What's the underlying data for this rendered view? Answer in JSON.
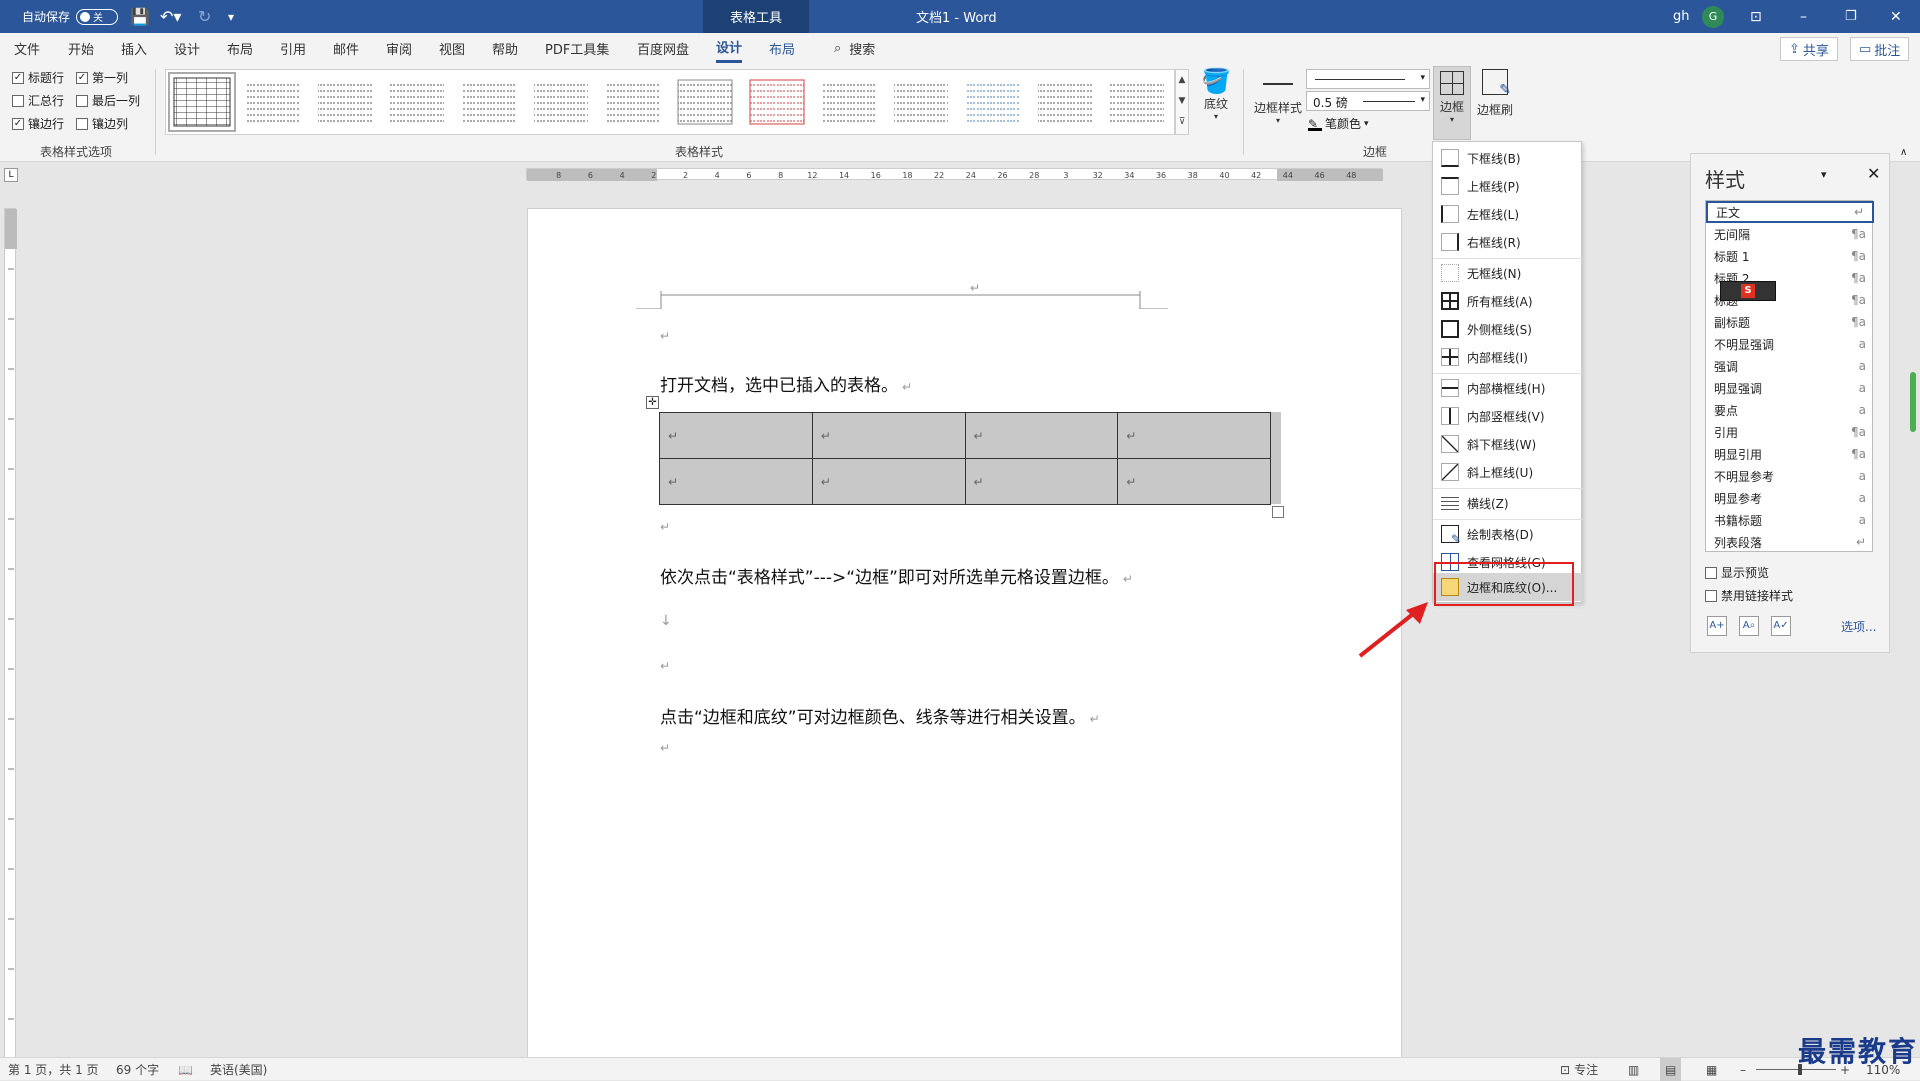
{
  "titlebar": {
    "autosave": "自动保存",
    "toggle": "关",
    "context_tab": "表格工具",
    "doc_title": "文档1 - Word",
    "user": "gh",
    "avatar": "G",
    "minimize": "–",
    "restore": "❐",
    "close": "✕",
    "ribbon_display": "⊡"
  },
  "tabs": [
    "文件",
    "开始",
    "插入",
    "设计",
    "布局",
    "引用",
    "邮件",
    "审阅",
    "视图",
    "帮助",
    "PDF工具集",
    "百度网盘",
    "设计",
    "布局"
  ],
  "search": "搜索",
  "share": "共享",
  "comment": "批注",
  "options": {
    "header_row": "标题行",
    "first_col": "第一列",
    "total_row": "汇总行",
    "last_col": "最后一列",
    "banded_rows": "镶边行",
    "banded_cols": "镶边列",
    "group_label": "表格样式选项"
  },
  "gallery_label": "表格样式",
  "shading": "底纹",
  "border_styles": "边框样式",
  "line_weight": "0.5 磅",
  "pen_color": "笔颜色",
  "borders": "边框",
  "border_painter": "边框刷",
  "border_group_label": "边框",
  "colors": {
    "accent": "#2b579a",
    "highlight": "#e02020",
    "table_fill": "#c8c8c8"
  },
  "document": {
    "line1": "打开文档，选中已插入的表格。",
    "line2": "依次点击“表格样式”--->“边框”即可对所选单元格设置边框。",
    "line3": "点击“边框和底纹”可对边框颜色、线条等进行相关设置。",
    "para_mark": "↵",
    "down_arrow": "↓"
  },
  "ruler_h": [
    "8",
    "6",
    "4",
    "2",
    "2",
    "4",
    "6",
    "8",
    "12",
    "14",
    "16",
    "18",
    "22",
    "24",
    "26",
    "28",
    "3",
    "32",
    "34",
    "36",
    "38",
    "40",
    "42",
    "44",
    "46",
    "48"
  ],
  "dropdown": [
    {
      "label": "下框线(B)",
      "icon": "bottom-border-icon"
    },
    {
      "label": "上框线(P)",
      "icon": "top-border-icon"
    },
    {
      "label": "左框线(L)",
      "icon": "left-border-icon"
    },
    {
      "label": "右框线(R)",
      "icon": "right-border-icon"
    },
    {
      "label": "无框线(N)",
      "icon": "no-border-icon"
    },
    {
      "label": "所有框线(A)",
      "icon": "all-borders-icon"
    },
    {
      "label": "外侧框线(S)",
      "icon": "outside-borders-icon"
    },
    {
      "label": "内部框线(I)",
      "icon": "inside-borders-icon"
    },
    {
      "label": "内部横框线(H)",
      "icon": "inside-horizontal-icon"
    },
    {
      "label": "内部竖框线(V)",
      "icon": "inside-vertical-icon"
    },
    {
      "label": "斜下框线(W)",
      "icon": "diagonal-down-icon"
    },
    {
      "label": "斜上框线(U)",
      "icon": "diagonal-up-icon"
    },
    {
      "label": "横线(Z)",
      "icon": "horizontal-line-icon"
    },
    {
      "label": "绘制表格(D)",
      "icon": "draw-table-icon"
    },
    {
      "label": "查看网格线(G)",
      "icon": "view-gridlines-icon"
    },
    {
      "label": "边框和底纹(O)...",
      "icon": "borders-shading-icon"
    }
  ],
  "styles_panel": {
    "title": "样式",
    "items": [
      {
        "name": "正文",
        "mark": "↵"
      },
      {
        "name": "无间隔",
        "mark": "¶a"
      },
      {
        "name": "标题 1",
        "mark": "¶a"
      },
      {
        "name": "标题 2",
        "mark": "¶a"
      },
      {
        "name": "标题",
        "mark": "¶a"
      },
      {
        "name": "副标题",
        "mark": "¶a"
      },
      {
        "name": "不明显强调",
        "mark": "a"
      },
      {
        "name": "强调",
        "mark": "a"
      },
      {
        "name": "明显强调",
        "mark": "a"
      },
      {
        "name": "要点",
        "mark": "a"
      },
      {
        "name": "引用",
        "mark": "¶a"
      },
      {
        "name": "明显引用",
        "mark": "¶a"
      },
      {
        "name": "不明显参考",
        "mark": "a"
      },
      {
        "name": "明显参考",
        "mark": "a"
      },
      {
        "name": "书籍标题",
        "mark": "a"
      },
      {
        "name": "列表段落",
        "mark": "↵"
      }
    ],
    "show_preview": "显示预览",
    "disable_linked": "禁用链接样式",
    "options": "选项..."
  },
  "status": {
    "page": "第 1 页，共 1 页",
    "words": "69 个字",
    "language": "英语(美国)",
    "focus": "专注",
    "zoom": "110%"
  },
  "watermark": "最需教育"
}
